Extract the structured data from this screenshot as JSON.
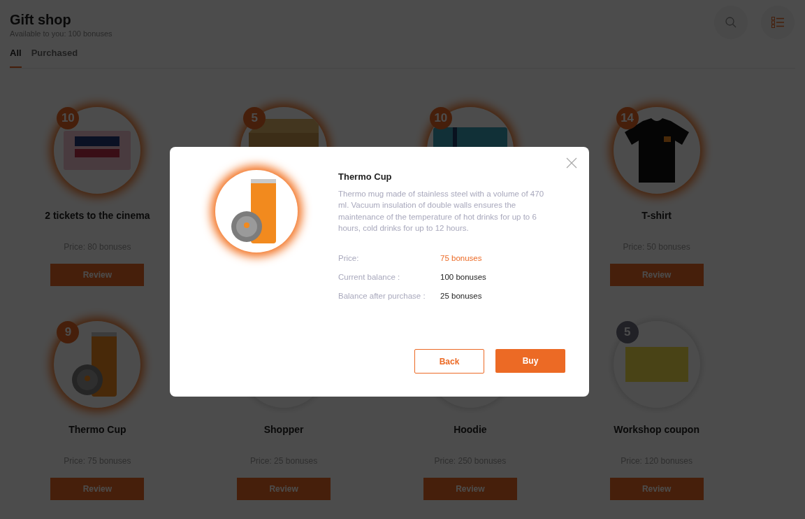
{
  "header": {
    "title": "Gift shop",
    "subtitle": "Available to you: 100 bonuses"
  },
  "tabs": [
    {
      "label": "All",
      "selected": true
    },
    {
      "label": "Purchased",
      "selected": false
    }
  ],
  "products": [
    {
      "kind": "ticket",
      "badge": "10",
      "glow": true,
      "name": "2 tickets to the cinema",
      "price": "Price: 80 bonuses",
      "button": "Review"
    },
    {
      "kind": "box",
      "badge": "5",
      "glow": true
    },
    {
      "kind": "giftcard",
      "badge": "10",
      "glow": true
    },
    {
      "kind": "tshirt",
      "badge": "14",
      "glow": true,
      "name": "T-shirt",
      "price": "Price: 50 bonuses",
      "button": "Review"
    },
    {
      "kind": "cup",
      "badge": "9",
      "glow": true,
      "name": "Thermo Cup",
      "price": "Price: 75 bonuses",
      "button": "Review"
    },
    {
      "kind": "hidden",
      "glow": false,
      "name": "Shopper",
      "price": "Price: 25 bonuses",
      "button": "Review"
    },
    {
      "kind": "hidden",
      "glow": false,
      "name": "Hoodie",
      "price": "Price: 250 bonuses",
      "button": "Review"
    },
    {
      "kind": "coupon",
      "badge": "5",
      "glow": false,
      "name": "Workshop coupon",
      "price": "Price: 120 bonuses",
      "button": "Review"
    }
  ],
  "dialog": {
    "title": "Thermo Cup",
    "description": "Thermo mug made of stainless steel with a volume of 470 ml. Vacuum insulation of double walls ensures the maintenance of the temperature of hot drinks for up to 6 hours, cold drinks for up to 12 hours.",
    "details": [
      {
        "label": "Price:",
        "value": "75 bonuses",
        "highlight": true
      },
      {
        "label": "Current balance :",
        "value": "100 bonuses",
        "highlight": false
      },
      {
        "label": "Balance after purchase :",
        "value": "25 bonuses",
        "highlight": false
      }
    ],
    "back": "Back",
    "buy": "Buy"
  }
}
